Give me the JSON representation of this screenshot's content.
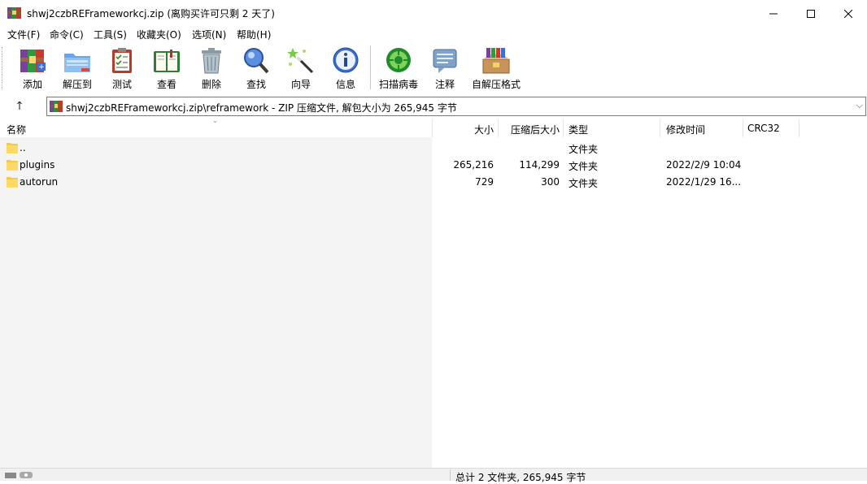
{
  "window": {
    "title": "shwj2czbREFrameworkcj.zip (离购买许可只剩 2 天了)",
    "minimize": "—",
    "maximize": "☐",
    "close": "✕"
  },
  "menu": {
    "items": [
      "文件(F)",
      "命令(C)",
      "工具(S)",
      "收藏夹(O)",
      "选项(N)",
      "帮助(H)"
    ]
  },
  "toolbar": {
    "tools": [
      {
        "label": "添加",
        "icon": "add-archive-icon"
      },
      {
        "label": "解压到",
        "icon": "extract-folder-icon"
      },
      {
        "label": "测试",
        "icon": "test-clipboard-icon"
      },
      {
        "label": "查看",
        "icon": "view-book-icon"
      },
      {
        "label": "删除",
        "icon": "trash-icon"
      },
      {
        "label": "查找",
        "icon": "magnifier-icon"
      },
      {
        "label": "向导",
        "icon": "wizard-wand-icon"
      },
      {
        "label": "信息",
        "icon": "info-icon"
      },
      {
        "label": "扫描病毒",
        "icon": "virus-scan-icon"
      },
      {
        "label": "注释",
        "icon": "comment-icon"
      },
      {
        "label": "自解压格式",
        "icon": "sfx-box-icon"
      }
    ]
  },
  "address": {
    "up": "↑",
    "path": "shwj2czbREFrameworkcj.zip\\reframework - ZIP 压缩文件, 解包大小为 265,945 字节",
    "dropdown": "⌵"
  },
  "columns": {
    "name": "名称",
    "size": "大小",
    "packed": "压缩后大小",
    "type": "类型",
    "modified": "修改时间",
    "crc": "CRC32"
  },
  "files": [
    {
      "name": "..",
      "size": "",
      "packed": "",
      "type": "文件夹",
      "modified": "",
      "crc": ""
    },
    {
      "name": "plugins",
      "size": "265,216",
      "packed": "114,299",
      "type": "文件夹",
      "modified": "2022/2/9 10:04",
      "crc": ""
    },
    {
      "name": "autorun",
      "size": "729",
      "packed": "300",
      "type": "文件夹",
      "modified": "2022/1/29 16...",
      "crc": ""
    }
  ],
  "status": {
    "summary": "总计 2 文件夹, 265,945 字节"
  }
}
